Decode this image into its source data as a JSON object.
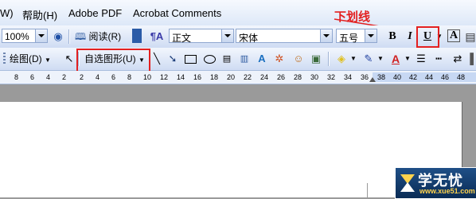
{
  "menu": {
    "items": [
      "W)",
      "帮助(H)",
      "Adobe PDF",
      "Acrobat Comments"
    ]
  },
  "toolbar_format": {
    "zoom": "100%",
    "read_button": "阅读(R)",
    "style": "正文",
    "font": "宋体",
    "size": "五号",
    "bold": "B",
    "italic": "I",
    "underline": "U",
    "font_color_a": "A"
  },
  "toolbar_draw": {
    "draw_menu": "绘图(D)",
    "autoshapes_menu": "自选图形(U)"
  },
  "ruler": {
    "ticks": [
      "8",
      "6",
      "4",
      "2",
      "2",
      "4",
      "6",
      "8",
      "10",
      "12",
      "14",
      "16",
      "18",
      "20",
      "22",
      "24",
      "26",
      "28",
      "30",
      "32",
      "34",
      "36",
      "38",
      "40",
      "42",
      "44",
      "46",
      "48"
    ]
  },
  "annotation": {
    "label": "下划线",
    "color": "#e32020"
  },
  "watermark": {
    "logo_text": "学无忧",
    "url": "www.xue51.com"
  }
}
